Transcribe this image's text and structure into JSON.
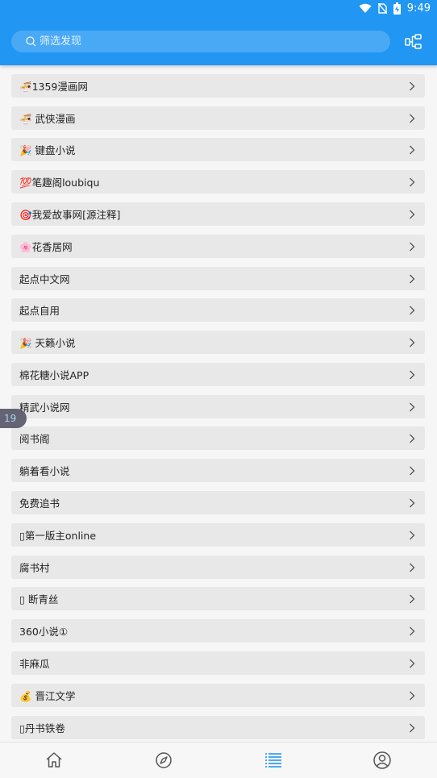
{
  "status": {
    "time": "9:49"
  },
  "search": {
    "placeholder": "筛选发现",
    "value": ""
  },
  "list": {
    "items": [
      "🍜1359漫画网",
      "🍜 武侠漫画",
      "🎉 键盘小说",
      "💯笔趣阁loubiqu",
      "🎯我爱故事网[源注释]",
      "🌸花香居网",
      "起点中文网",
      "起点自用",
      "🎉 天籁小说",
      "棉花糖小说APP",
      "精武小说网",
      "阅书阁",
      "躺着看小说",
      "免费追书",
      "▯第一版主online",
      "腐书村",
      "▯ 断青丝",
      "360小说①",
      "非麻瓜",
      "💰 晋江文学",
      "▯丹书铁卷"
    ]
  },
  "floating_badge": "19",
  "colors": {
    "primary": "#2196f3",
    "item_bg": "#e8e8e8",
    "active_tab": "#2196f3"
  },
  "nav": {
    "tabs": [
      {
        "icon": "home-icon",
        "active": false
      },
      {
        "icon": "discover-icon",
        "active": false
      },
      {
        "icon": "list-icon",
        "active": true
      },
      {
        "icon": "profile-icon",
        "active": false
      }
    ]
  }
}
